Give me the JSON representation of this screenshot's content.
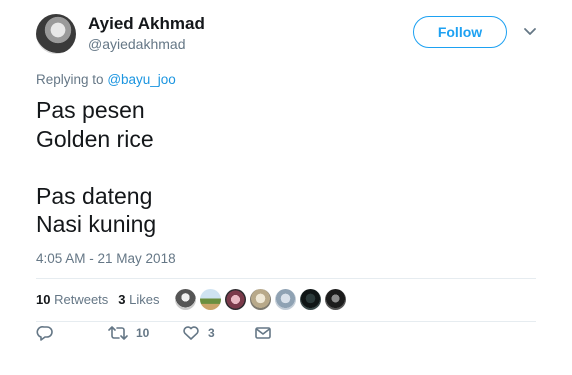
{
  "user": {
    "name": "Ayied Akhmad",
    "handle": "@ayiedakhmad"
  },
  "follow": {
    "label": "Follow"
  },
  "reply_context": {
    "prefix": "Replying to",
    "mention": "@bayu_joo"
  },
  "tweet": {
    "text": "Pas pesen\nGolden rice\n\nPas dateng\nNasi kuning"
  },
  "meta": {
    "timestamp": "4:05 AM - 21 May 2018"
  },
  "stats": {
    "retweets_count": "10",
    "retweets_label": "Retweets",
    "likes_count": "3",
    "likes_label": "Likes"
  },
  "actions": {
    "retweet_count": "10",
    "like_count": "3"
  },
  "colors": {
    "accent": "#1da1f2",
    "secondary_text": "#657786",
    "divider": "#e6ecf0"
  },
  "icons": [
    "reply-icon",
    "retweet-icon",
    "like-icon",
    "message-icon",
    "chevron-down-icon"
  ]
}
